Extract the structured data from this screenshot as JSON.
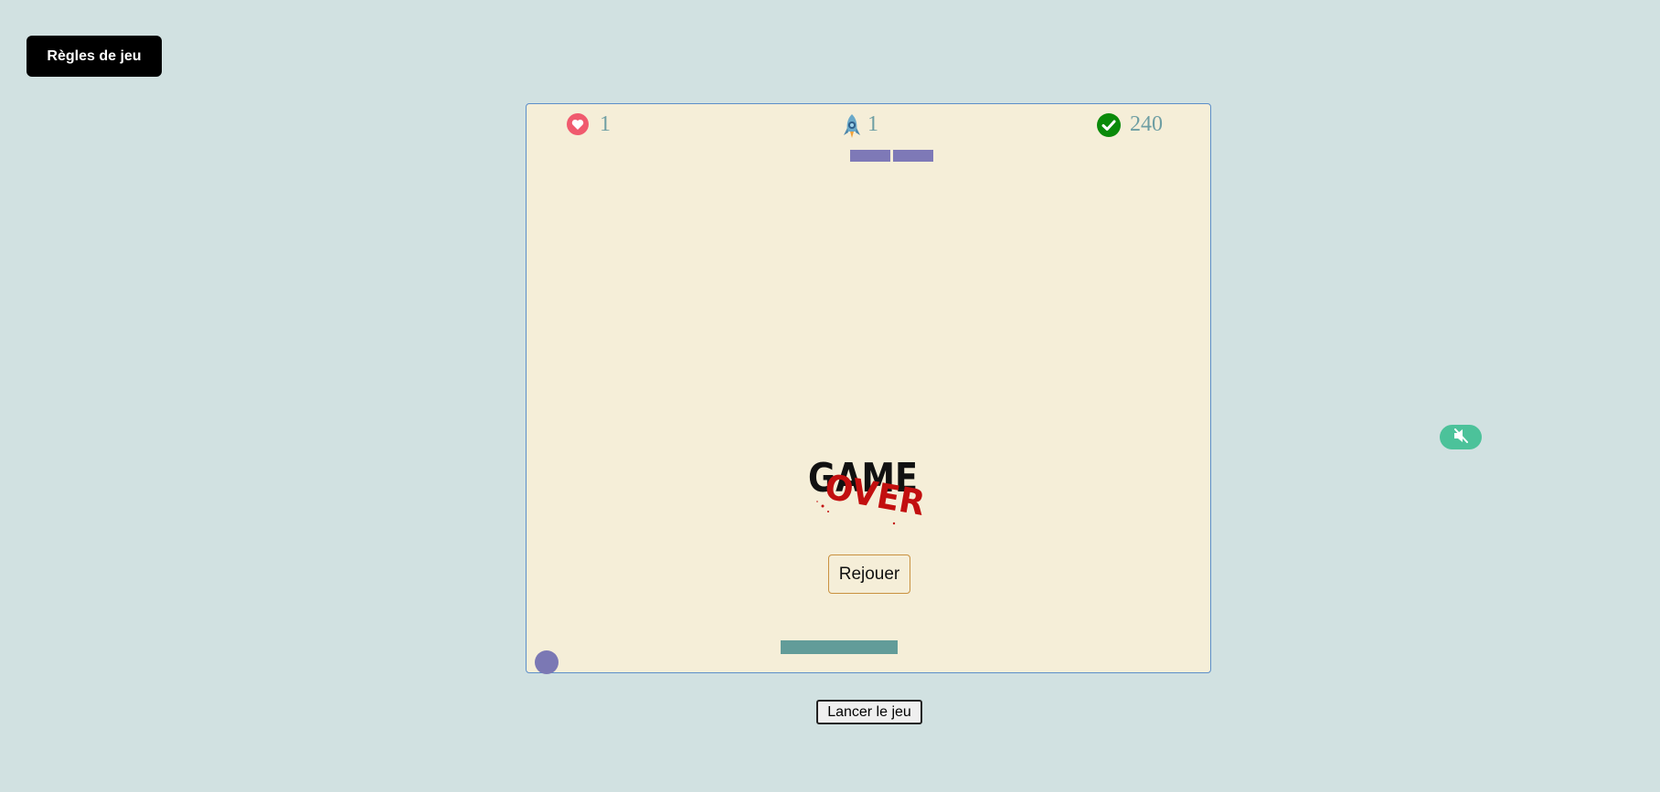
{
  "rules_button": {
    "label": "Règles de jeu"
  },
  "hud": {
    "lives": {
      "icon": "heart-icon",
      "value": "1"
    },
    "level": {
      "icon": "rocket-icon",
      "value": "1"
    },
    "score": {
      "icon": "check-circle-icon",
      "value": "240"
    }
  },
  "bricks": {
    "remaining": 2,
    "color": "#7e79b7"
  },
  "game_over": {
    "image": "game-over-logo",
    "text_top": "GAME",
    "text_bottom": "OVER"
  },
  "replay_button": {
    "label": "Rejouer"
  },
  "launch_button": {
    "label": "Lancer le jeu"
  },
  "sound_toggle": {
    "icon": "speaker-muted-icon",
    "state": "muted"
  },
  "colors": {
    "background": "#d1e1e1",
    "board": "#f5eed8",
    "paddle": "#629c99",
    "ball": "#7b78b4",
    "accent_green": "#4cc29a"
  }
}
